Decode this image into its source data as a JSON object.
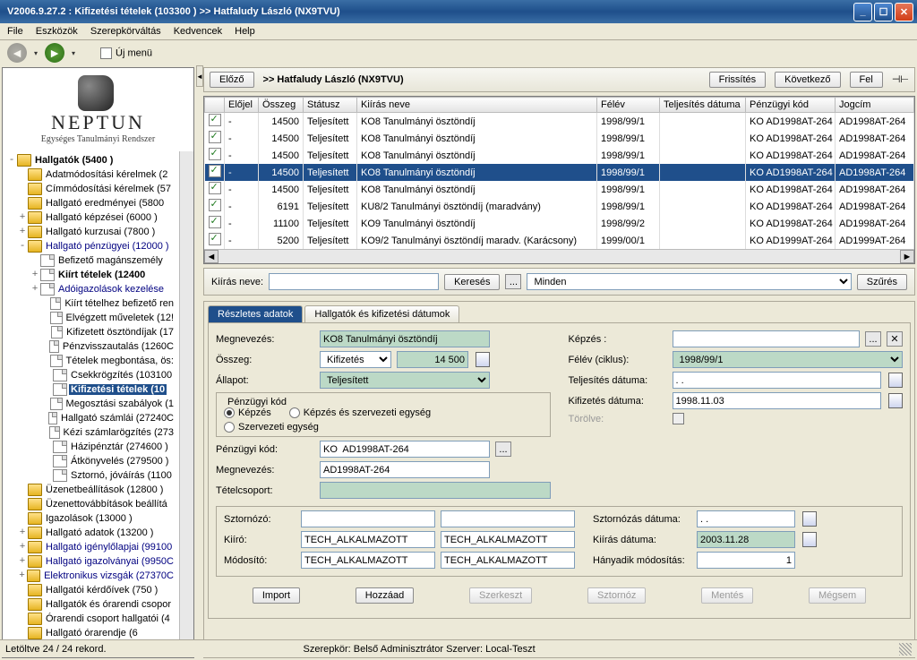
{
  "window": {
    "title": "V2006.9.27.2 : Kifizetési tételek (103300  )   >> Hatfaludy László (NX9TVU)"
  },
  "menu": {
    "file": "File",
    "tools": "Eszközök",
    "role": "Szerepkörváltás",
    "fav": "Kedvencek",
    "help": "Help"
  },
  "nav": {
    "newmenu": "Új menü"
  },
  "logo": {
    "title": "NEPTUN",
    "subtitle": "Egységes Tanulmányi Rendszer"
  },
  "tree": {
    "root": "Hallgatók (5400  )",
    "n1": "Adatmódosítási kérelmek (2",
    "n2": "Címmódosítási kérelmek (57",
    "n3": "Hallgató eredményei (5800",
    "n4": "Hallgató képzései (6000  )",
    "n5": "Hallgató kurzusai (7800  )",
    "n6": "Hallgató pénzügyei (12000 )",
    "n6a": "Befizető magánszemély",
    "n6b": "Kiírt tételek (12400",
    "n6c": "Adóigazolások kezelése",
    "n6d": "Kiírt tételhez befizető ren",
    "n6e": "Elvégzett műveletek (12!",
    "n6f": "Kifizetett ösztöndíjak (17",
    "n6g": "Pénzvisszautalás (1260C",
    "n6h": "Tételek megbontása, ös:",
    "n6i": "Csekkrögzítés (103100",
    "n6j": "Kifizetési tételek (10",
    "n6k": "Megosztási szabályok (1",
    "n6l": "Hallgató számlái (27240C",
    "n6m": "Kézi számlarögzítés (273",
    "n6n": "Házipénztár (274600  )",
    "n6o": "Átkönyvelés (279500  )",
    "n6p": "Sztornó, jóváírás (1100",
    "n7": "Üzenetbeállítások (12800  )",
    "n8": "Üzenettovábbítások beállítá",
    "n9": "Igazolások (13000  )",
    "n10": "Hallgató adatok (13200  )",
    "n11": "Hallgató igénylőlapjai (99100",
    "n12": "Hallgató igazolványai (9950C",
    "n13": "Elektronikus vizsgák (27370C",
    "n14": "Hallgatói kérdőívek (750  )",
    "n15": "Hallgatók és órarendi csopor",
    "n16": "Órarendi csoport hallgatói (4",
    "n17": "Hallgató órarendje (6"
  },
  "toolbar": {
    "prev": "Előző",
    "title": ">>  Hatfaludy László (NX9TVU)",
    "refresh": "Frissítés",
    "next": "Következő",
    "up": "Fel"
  },
  "grid": {
    "headers": {
      "c0": "",
      "c1": "Előjel",
      "c2": "Összeg",
      "c3": "Státusz",
      "c4": "Kiírás neve",
      "c5": "Félév",
      "c6": "Teljesítés dátuma",
      "c7": "Pénzügyi kód",
      "c8": "Jogcím"
    },
    "rows": [
      {
        "elo": "-",
        "ossz": "14500",
        "stat": "Teljesített",
        "kiir": "KO8 Tanulmányi ösztöndíj",
        "fel": "1998/99/1",
        "pkod": "KO  AD1998AT-264",
        "jog": "AD1998AT-264"
      },
      {
        "elo": "-",
        "ossz": "14500",
        "stat": "Teljesített",
        "kiir": "KO8 Tanulmányi ösztöndíj",
        "fel": "1998/99/1",
        "pkod": "KO  AD1998AT-264",
        "jog": "AD1998AT-264"
      },
      {
        "elo": "-",
        "ossz": "14500",
        "stat": "Teljesített",
        "kiir": "KO8 Tanulmányi ösztöndíj",
        "fel": "1998/99/1",
        "pkod": "KO  AD1998AT-264",
        "jog": "AD1998AT-264"
      },
      {
        "elo": "-",
        "ossz": "14500",
        "stat": "Teljesített",
        "kiir": "KO8 Tanulmányi ösztöndíj",
        "fel": "1998/99/1",
        "pkod": "KO  AD1998AT-264",
        "jog": "AD1998AT-264",
        "sel": true
      },
      {
        "elo": "-",
        "ossz": "14500",
        "stat": "Teljesített",
        "kiir": "KO8 Tanulmányi ösztöndíj",
        "fel": "1998/99/1",
        "pkod": "KO  AD1998AT-264",
        "jog": "AD1998AT-264"
      },
      {
        "elo": "-",
        "ossz": "6191",
        "stat": "Teljesített",
        "kiir": "KU8/2 Tanulmányi ösztöndíj (maradvány)",
        "fel": "1998/99/1",
        "pkod": "KO  AD1998AT-264",
        "jog": "AD1998AT-264"
      },
      {
        "elo": "-",
        "ossz": "11100",
        "stat": "Teljesített",
        "kiir": "KO9 Tanulmányi ösztöndíj",
        "fel": "1998/99/2",
        "pkod": "KO  AD1998AT-264",
        "jog": "AD1998AT-264"
      },
      {
        "elo": "-",
        "ossz": "5200",
        "stat": "Teljesített",
        "kiir": "KO9/2 Tanulmányi ösztöndíj maradv. (Karácsony)",
        "fel": "1999/00/1",
        "pkod": "KO  AD1999AT-264",
        "jog": "AD1999AT-264"
      }
    ]
  },
  "search": {
    "label": "Kiírás neve:",
    "btnSearch": "Keresés",
    "btnDots": "...",
    "dd": "Minden",
    "btnFilter": "Szűrés"
  },
  "tabs": {
    "t1": "Részletes adatok",
    "t2": "Hallgatók és kifizetési dátumok"
  },
  "form": {
    "megnevezes_l": "Megnevezés:",
    "megnevezes_v": "KO8 Tanulmányi ösztöndíj",
    "osszeg_l": "Összeg:",
    "osszeg_dd": "Kifizetés",
    "osszeg_v": "14 500",
    "allapot_l": "Állapot:",
    "allapot_v": "Teljesített",
    "fs_title": "Pénzügyi kód",
    "r1": "Képzés",
    "r2": "Szervezeti egység",
    "r3": "Képzés és szervezeti egység",
    "pkod_l": "Pénzügyi kód:",
    "pkod_v": "KO  AD1998AT-264",
    "megn2_l": "Megnevezés:",
    "megn2_v": "AD1998AT-264",
    "tcs_l": "Tételcsoport:",
    "kepzes_l": "Képzés :",
    "felev_l": "Félév (ciklus):",
    "felev_v": "1998/99/1",
    "telj_l": "Teljesítés dátuma:",
    "telj_v": ". .",
    "kif_l": "Kifizetés dátuma:",
    "kif_v": "1998.11.03",
    "torolve_l": "Törölve:",
    "sztornozo_l": "Sztornózó:",
    "kiiro_l": "Kiíró:",
    "kiiro_v1": "TECH_ALKALMAZOTT",
    "kiiro_v2": "TECH_ALKALMAZOTT",
    "mod_l": "Módosító:",
    "mod_v1": "TECH_ALKALMAZOTT",
    "mod_v2": "TECH_ALKALMAZOTT",
    "szd_l": "Sztornózás dátuma:",
    "szd_v": ". .",
    "kd_l": "Kiírás dátuma:",
    "kd_v": "2003.11.28",
    "hm_l": "Hányadik módosítás:",
    "hm_v": "1"
  },
  "buttons": {
    "import": "Import",
    "add": "Hozzáad",
    "edit": "Szerkeszt",
    "cancel": "Sztornóz",
    "save": "Mentés",
    "abort": "Mégsem"
  },
  "status": {
    "left": "Letöltve 24 / 24 rekord.",
    "mid": "Szerepkör: Belső Adminisztrátor   Szerver: Local-Teszt"
  }
}
